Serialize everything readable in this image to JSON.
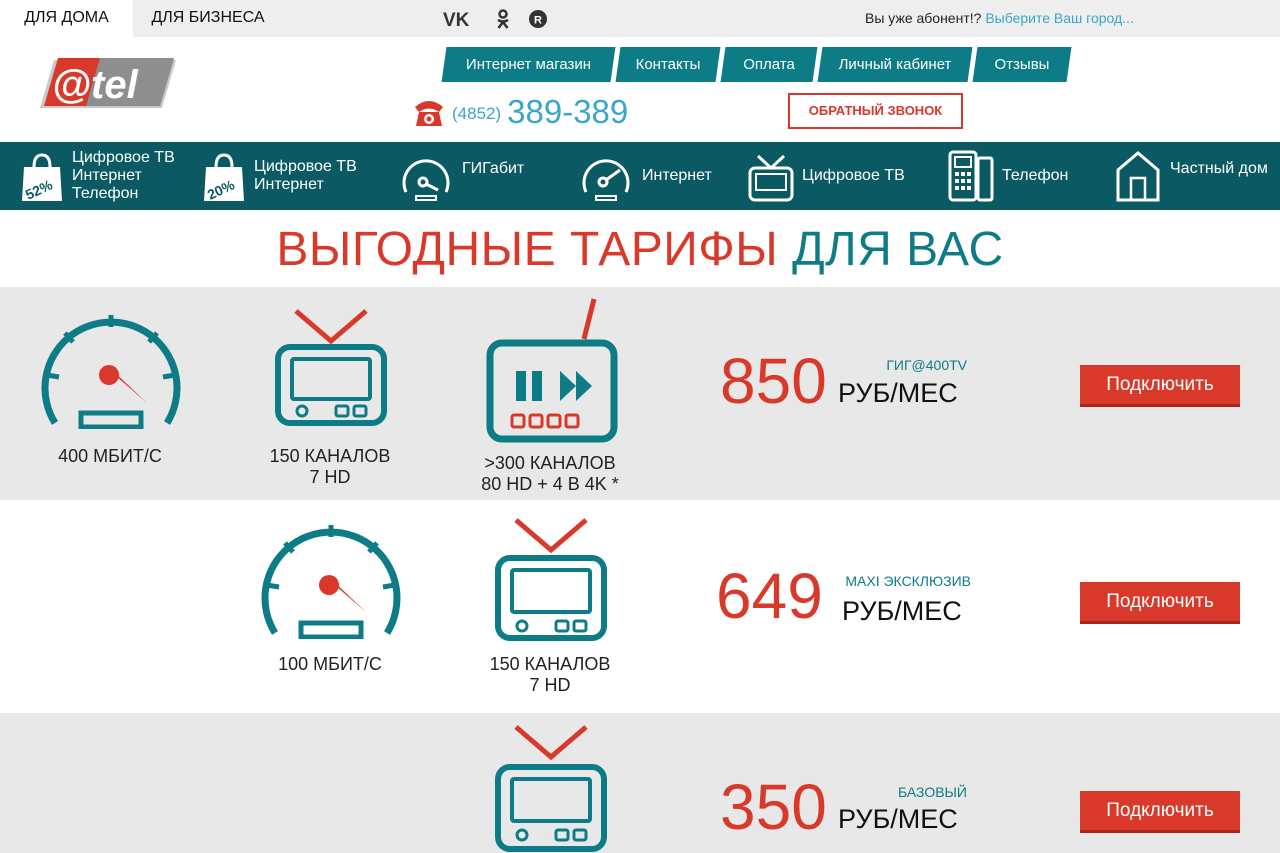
{
  "top": {
    "tabs": [
      "ДЛЯ ДОМА",
      "ДЛЯ БИЗНЕСА"
    ],
    "subscriber_text": "Вы уже абонент!?",
    "city_link": "Выберите Ваш город...",
    "social_icons": [
      "vk-icon",
      "odnoklassniki-icon",
      "rutube-icon"
    ]
  },
  "header": {
    "logo_text": "@tel",
    "nav": [
      "Интернет магазин",
      "Контакты",
      "Оплата",
      "Личный кабинет",
      "Отзывы"
    ],
    "phone_code": "(4852)",
    "phone_number": "389-389",
    "callback": "ОБРАТНЫЙ ЗВОНОК"
  },
  "categories": [
    {
      "label": "Цифровое ТВ\nИнтернет\nТелефон",
      "icon": "discount-bag-icon",
      "badge": "52%"
    },
    {
      "label": "Цифровое ТВ\nИнтернет",
      "icon": "discount-bag-icon",
      "badge": "20%"
    },
    {
      "label": "ГИГабит",
      "icon": "speedometer-icon"
    },
    {
      "label": "Интернет",
      "icon": "speedometer-icon"
    },
    {
      "label": "Цифровое ТВ",
      "icon": "tv-icon"
    },
    {
      "label": "Телефон",
      "icon": "phone-device-icon"
    },
    {
      "label": "Частный дом",
      "icon": "house-icon"
    }
  ],
  "headline": {
    "red": "ВЫГОДНЫЕ ТАРИФЫ",
    "teal": "ДЛЯ ВАС"
  },
  "tariffs": [
    {
      "speed": "400 МБИТ/С",
      "channels": "150 КАНАЛОВ\n7 HD",
      "premium": ">300 КАНАЛОВ\n80 HD + 4 В 4K *",
      "price": "850",
      "name": "ГИГ@400TV",
      "unit": "РУБ/МЕС",
      "button": "Подключить"
    },
    {
      "speed": "100 МБИТ/С",
      "channels": "150 КАНАЛОВ\n7 HD",
      "price": "649",
      "name": "MAXI ЭКСКЛЮЗИВ",
      "unit": "РУБ/МЕС",
      "button": "Подключить"
    },
    {
      "price": "350",
      "name": "БАЗОВЫЙ",
      "unit": "РУБ/МЕС",
      "button": "Подключить"
    }
  ],
  "colors": {
    "accent_red": "#d9392a",
    "teal": "#0d7c86",
    "dark_teal": "#0b5a63",
    "link_blue": "#3aa6c9"
  }
}
